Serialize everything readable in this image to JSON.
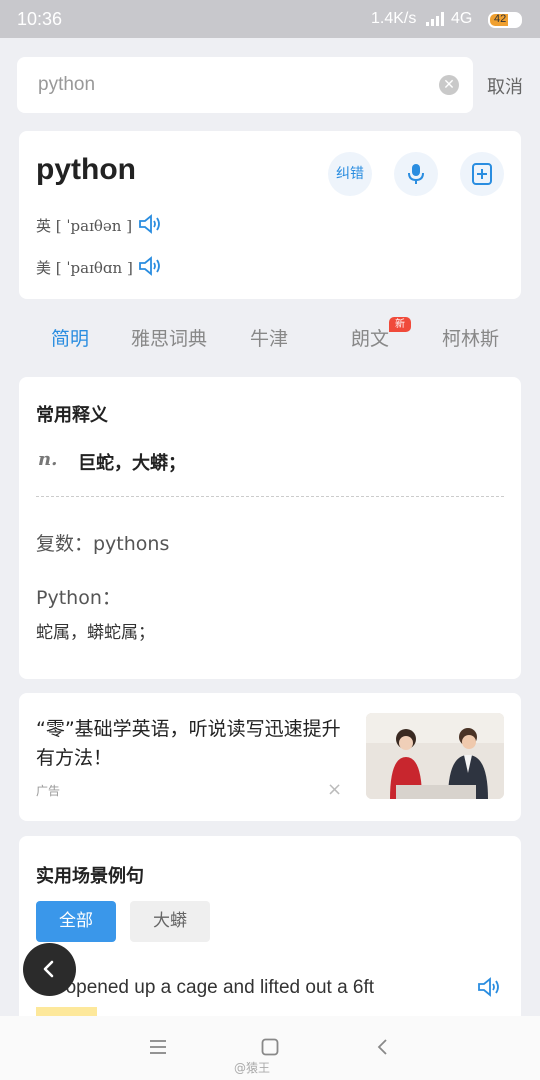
{
  "status_bar": {
    "time": "10:36",
    "network_speed": "1.4K/s",
    "network_type": "4G",
    "battery": "42"
  },
  "search": {
    "query": "python",
    "cancel_label": "取消"
  },
  "word": {
    "headword": "python",
    "correct_label": "纠错",
    "uk_label": "英",
    "uk_phonetic": "[ ˈpaɪθən ]",
    "us_label": "美",
    "us_phonetic": "[ ˈpaɪθɑn ]"
  },
  "dict_tabs": [
    {
      "label": "简明",
      "active": true
    },
    {
      "label": "雅思词典",
      "active": false
    },
    {
      "label": "牛津",
      "active": false
    },
    {
      "label": "朗文",
      "active": false,
      "badge": "新"
    },
    {
      "label": "柯林斯",
      "active": false
    }
  ],
  "definitions": {
    "title": "常用释义",
    "pos": "n.",
    "meaning": "巨蛇，大蟒；",
    "plural": "复数：pythons",
    "python_label": "Python：",
    "python_meaning": "蛇属，蟒蛇属；"
  },
  "ad": {
    "title": "“零”基础学英语，听说读写迅速提升有方法！",
    "label": "广告",
    "close": "×"
  },
  "examples": {
    "title": "实用场景例句",
    "filters": [
      "全部",
      "大蟒"
    ],
    "sentence": "He opened up a cage and lifted out a 6ft"
  },
  "watermark": "@猿王",
  "colors": {
    "accent": "#2a8de0",
    "badge": "#f04a3a",
    "status_bar": "#c8c8cc"
  }
}
